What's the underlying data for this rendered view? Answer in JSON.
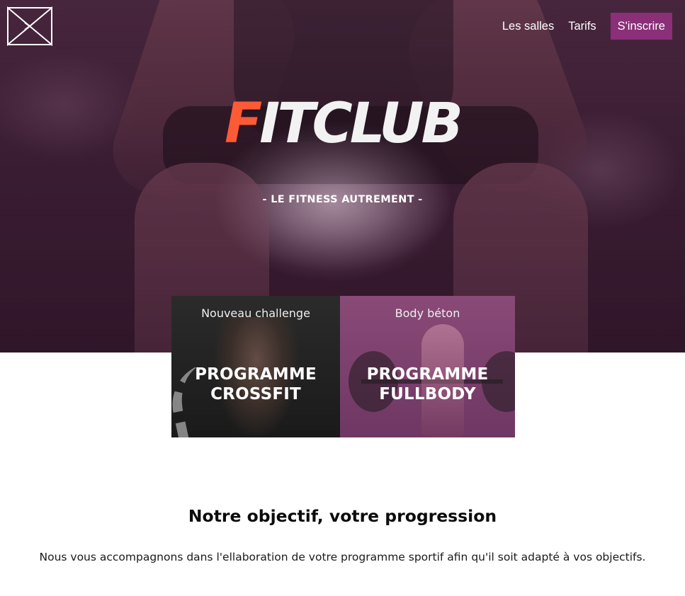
{
  "header": {
    "logo_icon": "bowtie-logo-icon",
    "nav": {
      "items": [
        {
          "label": "Les salles"
        },
        {
          "label": "Tarifs"
        }
      ],
      "signup_label": "S'inscrire",
      "signup_color": "#8a2f78"
    }
  },
  "hero": {
    "brand_accent": "F",
    "brand_rest": "ITCLUB",
    "accent_color": "#ff5a36",
    "tagline": "- LE FITNESS AUTREMENT -"
  },
  "cards": [
    {
      "kicker": "Nouveau challenge",
      "title_line1": "PROGRAMME",
      "title_line2": "CROSSFIT"
    },
    {
      "kicker": "Body béton",
      "title_line1": "PROGRAMME",
      "title_line2": "FULLBODY"
    }
  ],
  "section": {
    "title": "Notre objectif, votre progression",
    "text": "Nous vous accompagnons dans l'ellaboration de votre programme sportif afin qu'il soit adapté à vos objectifs."
  }
}
